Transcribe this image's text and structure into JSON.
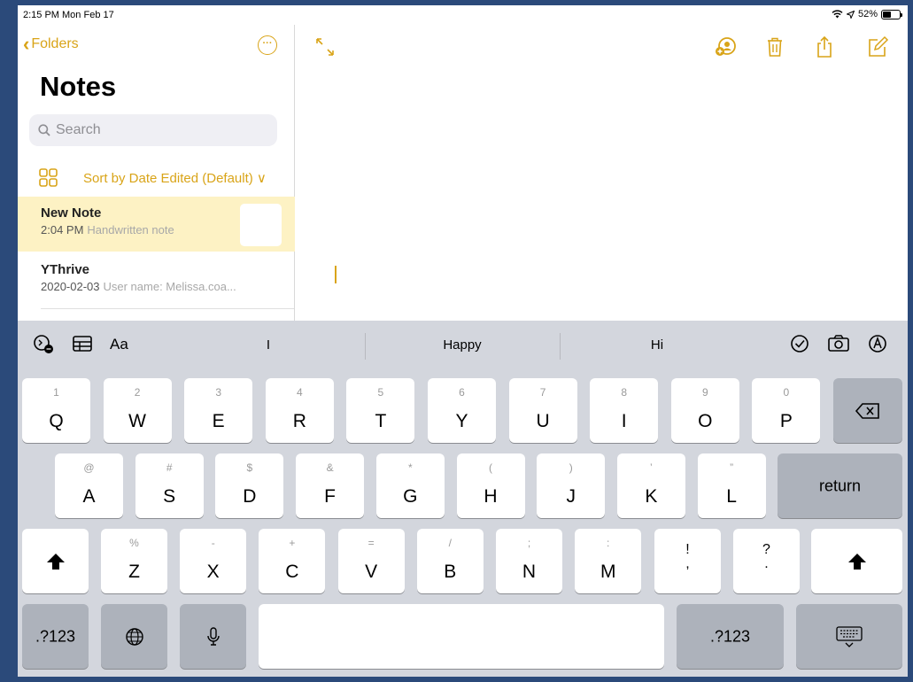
{
  "status": {
    "time": "2:15 PM  Mon Feb 17",
    "battery": "52%",
    "battery_level": 0.52
  },
  "sidebar": {
    "back_label": "Folders",
    "title": "Notes",
    "search_placeholder": "Search",
    "sort_label": "Sort by Date Edited (Default) ∨",
    "notes": [
      {
        "title": "New Note",
        "date": "2:04 PM",
        "preview": "Handwritten note"
      },
      {
        "title": "YThrive",
        "date": "2020-02-03",
        "preview": "User name: Melissa.coa..."
      }
    ]
  },
  "suggestions": {
    "aa": "Aa",
    "words": [
      "I",
      "Happy",
      "Hi"
    ]
  },
  "keyboard": {
    "row1": [
      {
        "alt": "1",
        "key": "Q"
      },
      {
        "alt": "2",
        "key": "W"
      },
      {
        "alt": "3",
        "key": "E"
      },
      {
        "alt": "4",
        "key": "R"
      },
      {
        "alt": "5",
        "key": "T"
      },
      {
        "alt": "6",
        "key": "Y"
      },
      {
        "alt": "7",
        "key": "U"
      },
      {
        "alt": "8",
        "key": "I"
      },
      {
        "alt": "9",
        "key": "O"
      },
      {
        "alt": "0",
        "key": "P"
      }
    ],
    "row2": [
      {
        "alt": "@",
        "key": "A"
      },
      {
        "alt": "#",
        "key": "S"
      },
      {
        "alt": "$",
        "key": "D"
      },
      {
        "alt": "&",
        "key": "F"
      },
      {
        "alt": "*",
        "key": "G"
      },
      {
        "alt": "(",
        "key": "H"
      },
      {
        "alt": ")",
        "key": "J"
      },
      {
        "alt": "’",
        "key": "K"
      },
      {
        "alt": "”",
        "key": "L"
      }
    ],
    "row3": [
      {
        "alt": "%",
        "key": "Z"
      },
      {
        "alt": "-",
        "key": "X"
      },
      {
        "alt": "+",
        "key": "C"
      },
      {
        "alt": "=",
        "key": "V"
      },
      {
        "alt": "/",
        "key": "B"
      },
      {
        "alt": ";",
        "key": "N"
      },
      {
        "alt": ":",
        "key": "M"
      }
    ],
    "excl": {
      "top": "!",
      "bottom": ","
    },
    "quest": {
      "top": "?",
      "bottom": "."
    },
    "return_label": "return",
    "numbers_label": ".?123"
  }
}
